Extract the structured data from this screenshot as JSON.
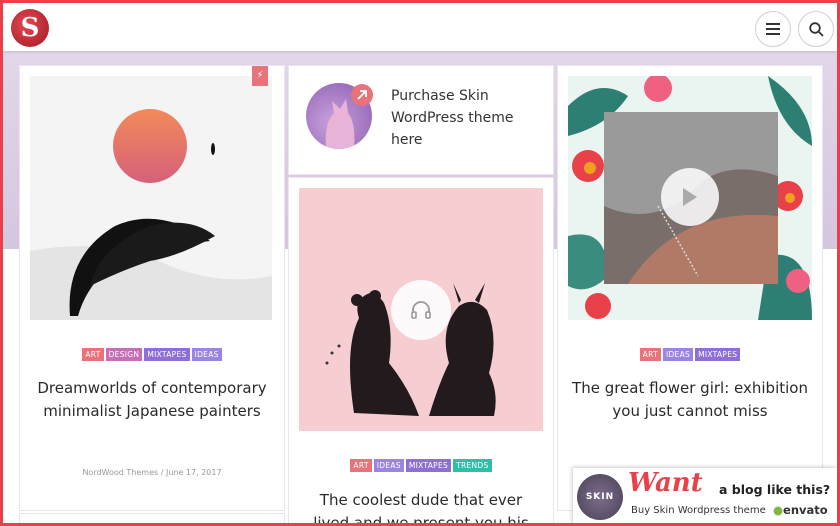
{
  "header": {
    "logo_letter": "S",
    "menu_icon": "hamburger-icon",
    "search_icon": "search-icon"
  },
  "colors": {
    "accent": "#e8414a",
    "band": "#d9cbe3",
    "tag_art": "#e8737a",
    "tag_design": "#c76fb5",
    "tag_mixtapes": "#8d6fd6",
    "tag_ideas": "#9c85e0",
    "tag_trends": "#2bc0a8"
  },
  "posts": [
    {
      "tags": [
        "ART",
        "DESIGN",
        "MIXTAPES",
        "IDEAS"
      ],
      "title": "Dreamworlds of contemporary minimalist Japanese painters",
      "author": "NordWood Themes",
      "date": "June 17, 2017",
      "format_icon": "flash-icon"
    },
    {
      "promo": "Purchase Skin WordPress theme here",
      "icon": "arrow-up-right-icon"
    },
    {
      "tags": [
        "ART",
        "IDEAS",
        "MIXTAPES",
        "TRENDS"
      ],
      "title": "The coolest dude that ever lived and we present you his",
      "format_icon": "headphones-icon"
    },
    {
      "tags": [
        "ART",
        "IDEAS",
        "MIXTAPES"
      ],
      "title": "The great flower girl: exhibition you just cannot miss",
      "format_icon": "play-icon"
    }
  ],
  "banner": {
    "want": "Want",
    "headline": "a blog like this?",
    "sub": "Buy Skin Wordpress theme",
    "brand": "envato",
    "avatar_text": "SKIN"
  }
}
